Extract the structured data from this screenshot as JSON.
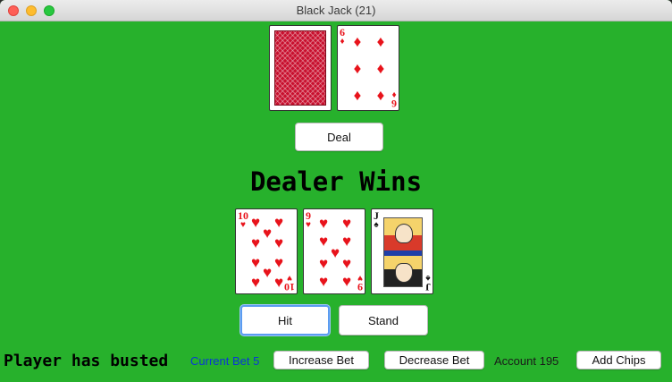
{
  "window": {
    "title": "Black Jack (21)"
  },
  "dealer": {
    "cards": [
      {
        "face_down": true,
        "suit_icon": "card-back"
      },
      {
        "rank": "6",
        "suit": "diamonds",
        "suit_glyph": "♦",
        "color": "#e8131b"
      }
    ]
  },
  "buttons": {
    "deal": "Deal",
    "hit": "Hit",
    "stand": "Stand",
    "increase_bet": "Increase Bet",
    "decrease_bet": "Decrease Bet",
    "add_chips": "Add Chips"
  },
  "result": "Dealer Wins",
  "player": {
    "cards": [
      {
        "rank": "10",
        "suit": "hearts",
        "suit_glyph": "♥",
        "color": "#e8131b"
      },
      {
        "rank": "9",
        "suit": "hearts",
        "suit_glyph": "♥",
        "color": "#e8131b"
      },
      {
        "rank": "J",
        "suit": "spades",
        "suit_glyph": "♠",
        "color": "#111111"
      }
    ]
  },
  "footer": {
    "status": "Player has busted",
    "current_bet": "Current Bet 5",
    "account": "Account 195"
  },
  "colors": {
    "felt": "#27b12c",
    "current_bet_text": "#0a36d8",
    "red_suit": "#e8131b"
  }
}
